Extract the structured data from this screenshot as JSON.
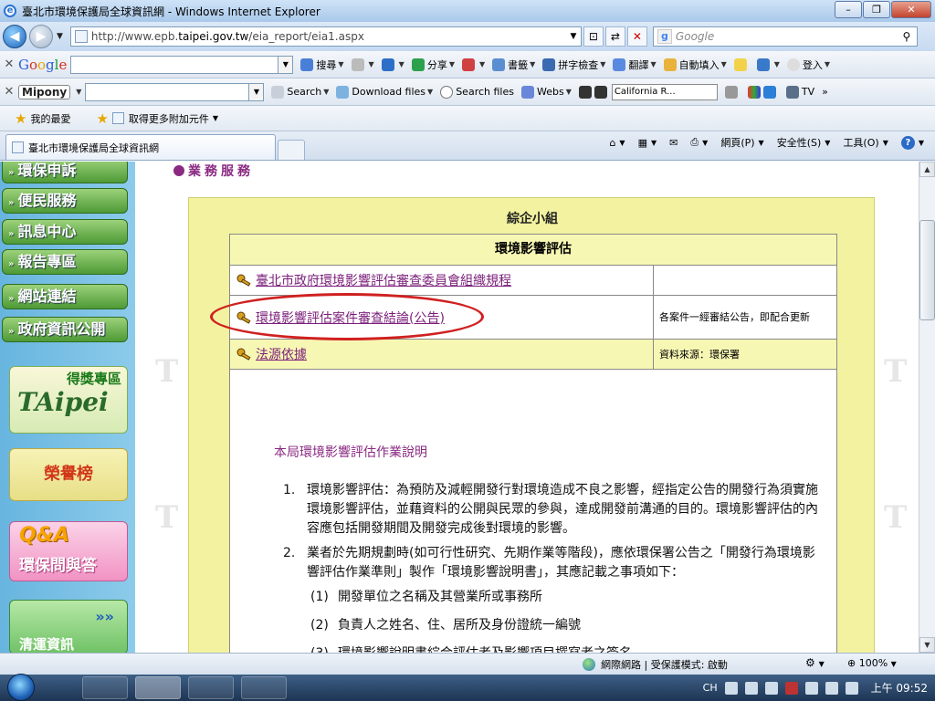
{
  "window": {
    "title": "臺北市環境保護局全球資訊網 - Windows Internet Explorer",
    "min": "–",
    "max": "❐",
    "close": "✕"
  },
  "nav": {
    "url_prefix": "http://www.epb.",
    "url_domain": "taipei.gov.tw",
    "url_suffix": "/eia_report/eia1.aspx",
    "search_placeholder": "Google"
  },
  "google_toolbar": {
    "brand": "Google",
    "search": "搜尋",
    "share": "分享",
    "bookmarks": "書籤",
    "spellcheck": "拼字檢查",
    "translate": "翻譯",
    "autofill": "自動填入",
    "login": "登入"
  },
  "mipony_toolbar": {
    "brand": "Mipony",
    "search": "Search",
    "download": "Download files",
    "search_files": "Search files",
    "webs": "Webs",
    "tv_channel": "California R...",
    "tv": "TV"
  },
  "favorites": {
    "fav": "我的最愛",
    "addons": "取得更多附加元件"
  },
  "tab": {
    "title": "臺北市環境保護局全球資訊網"
  },
  "commandbar": {
    "page": "網頁(P)",
    "safety": "安全性(S)",
    "tools": "工具(O)"
  },
  "sidebar": {
    "items": [
      {
        "label": "環保申訴"
      },
      {
        "label": "便民服務"
      },
      {
        "label": "訊息中心"
      },
      {
        "label": "報告專區"
      },
      {
        "label": "網站連結"
      },
      {
        "label": "政府資訊公開"
      }
    ],
    "banner_award": "得獎專區",
    "banner_honor": "榮譽榜",
    "banner_qa_title": "Q&A",
    "banner_qa": "環保問與答",
    "banner_truck": "清運資訊"
  },
  "content": {
    "crumb": "業務服務",
    "panel_title": "綜企小組",
    "section": "環境影響評估",
    "rows": [
      {
        "link": "臺北市政府環境影響評估審查委員會組織規程",
        "note": ""
      },
      {
        "link": "環境影響評估案件審查結論(公告)",
        "note": "各案件一經審結公告，即配合更新"
      },
      {
        "link": "法源依據",
        "note": "資料來源：環保署"
      }
    ],
    "intro": "本局環境影響評估作業說明",
    "list": [
      {
        "n": "1.",
        "text": "環境影響評估：為預防及減輕開發行對環境造成不良之影響，經指定公告的開發行為須實施環境影響評估，並藉資料的公開與民眾的參與，達成開發前溝通的目的。環境影響評估的內容應包括開發期間及開發完成後對環境的影響。"
      },
      {
        "n": "2.",
        "text": "業者於先期規劃時(如可行性研究、先期作業等階段)，應依環保署公告之「開發行為環境影響評估作業準則」製作「環境影響說明書」，其應記載之事項如下："
      }
    ],
    "sublist": [
      {
        "n": "(1)",
        "text": "開發單位之名稱及其營業所或事務所"
      },
      {
        "n": "(2)",
        "text": "負責人之姓名、住、居所及身份證統一編號"
      },
      {
        "n": "(3)",
        "text": "環境影響說明書綜合評估者及影響項目撰寫者之簽名"
      }
    ]
  },
  "status": {
    "zone": "網際網路 | 受保護模式: 啟動",
    "zoom": "100%"
  },
  "taskbar": {
    "lang": "CH",
    "clock": "上午 09:52"
  }
}
